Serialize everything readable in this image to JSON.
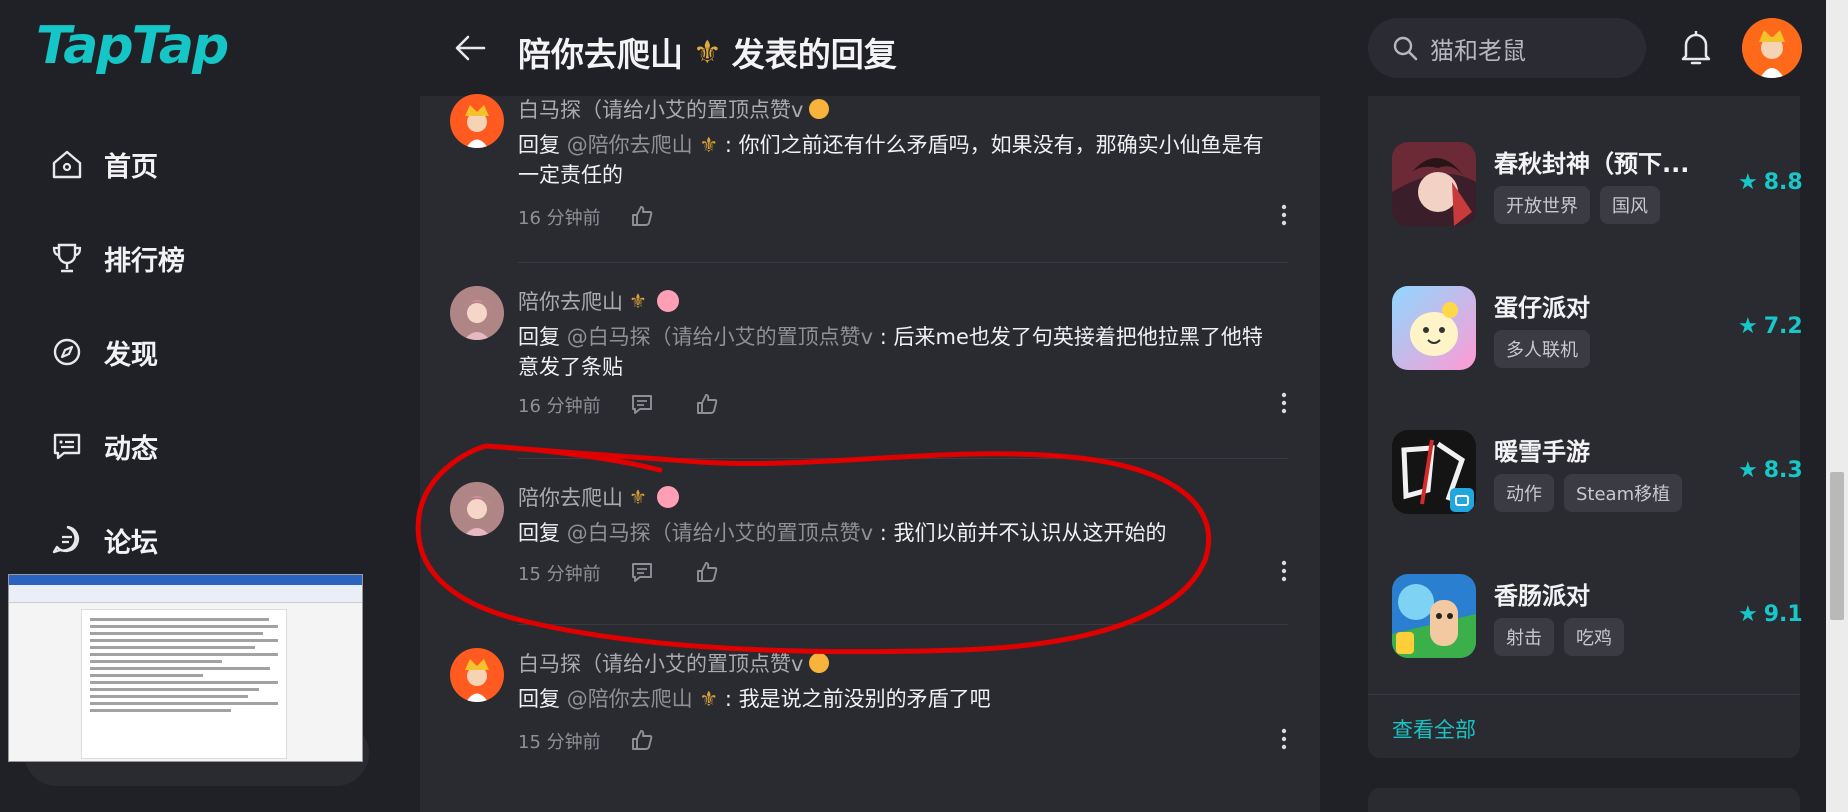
{
  "logo": "TapTap",
  "nav": [
    {
      "label": "首页",
      "icon": "home-icon"
    },
    {
      "label": "排行榜",
      "icon": "trophy-icon"
    },
    {
      "label": "发现",
      "icon": "discover-icon"
    },
    {
      "label": "动态",
      "icon": "feed-icon"
    },
    {
      "label": "论坛",
      "icon": "forum-icon"
    }
  ],
  "header": {
    "title_user": "陪你去爬山",
    "title_suffix": "发表的回复",
    "search_placeholder": "猫和老鼠"
  },
  "replies": [
    {
      "user": "白马探（请给小艾的置顶点赞v",
      "prefix": "回复 ",
      "mention": "@陪你去爬山",
      "text": " : 你们之前还有什么矛盾吗，如果没有，那确实小仙鱼是有一定责任的",
      "time": "16 分钟前",
      "has_comment": false
    },
    {
      "user": "陪你去爬山",
      "prefix": "回复 ",
      "mention": "@白马探（请给小艾的置顶点赞v",
      "text": " : 后来me也发了句英接着把他拉黑了他特意发了条贴",
      "time": "16 分钟前",
      "has_comment": true
    },
    {
      "user": "陪你去爬山",
      "prefix": "回复 ",
      "mention": "@白马探（请给小艾的置顶点赞v",
      "text": " : 我们以前并不认识从这开始的",
      "time": "15 分钟前",
      "has_comment": true
    },
    {
      "user": "白马探（请给小艾的置顶点赞v",
      "prefix": "回复 ",
      "mention": "@陪你去爬山",
      "text": " : 我是说之前没别的矛盾了吧",
      "time": "15 分钟前",
      "has_comment": false
    }
  ],
  "games": [
    {
      "name": "春秋封神（预下...",
      "tags": [
        "开放世界",
        "国风"
      ],
      "rating": "8.8"
    },
    {
      "name": "蛋仔派对",
      "tags": [
        "多人联机"
      ],
      "rating": "7.2"
    },
    {
      "name": "暖雪手游",
      "tags": [
        "动作",
        "Steam移植"
      ],
      "rating": "8.3"
    },
    {
      "name": "香肠派对",
      "tags": [
        "射击",
        "吃鸡"
      ],
      "rating": "9.1"
    }
  ],
  "see_all": "查看全部",
  "colors": {
    "accent": "#17c4c4",
    "background": "#202126",
    "card": "#2a2b31",
    "annotation": "#e00000"
  }
}
